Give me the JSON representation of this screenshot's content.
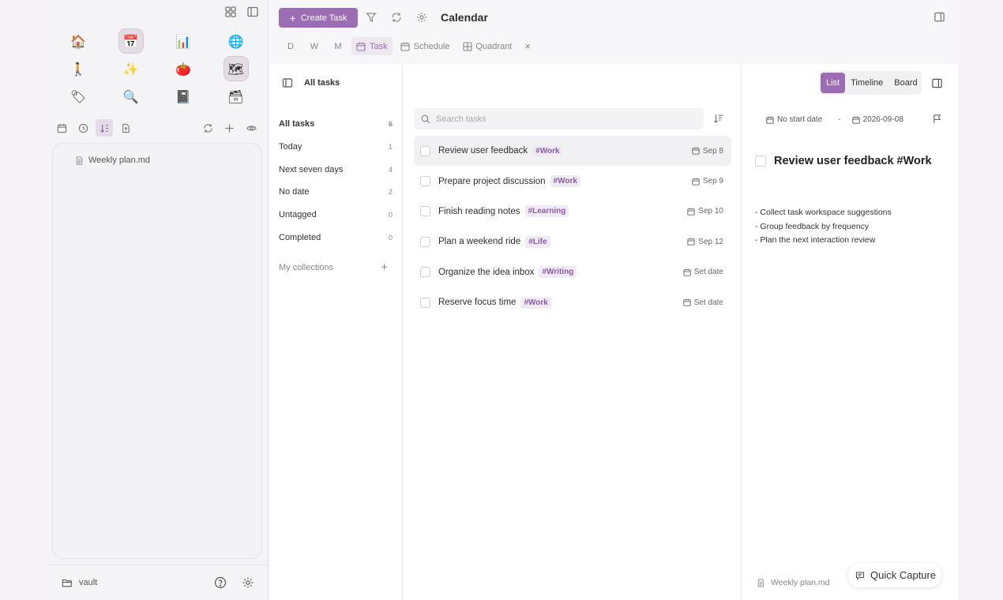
{
  "sidebar": {
    "emoji_icons": [
      {
        "name": "home-icon",
        "glyph": "🏠",
        "active": false
      },
      {
        "name": "calendar-icon",
        "glyph": "📅",
        "active": true
      },
      {
        "name": "bar-chart-icon",
        "glyph": "📊",
        "active": false
      },
      {
        "name": "globe-icon",
        "glyph": "🌐",
        "active": false
      },
      {
        "name": "walking-person-icon",
        "glyph": "🚶",
        "active": false
      },
      {
        "name": "sparkles-icon",
        "glyph": "✨",
        "active": false
      },
      {
        "name": "tomato-icon",
        "glyph": "🍅",
        "active": false
      },
      {
        "name": "map-icon",
        "glyph": "🗺",
        "active": true
      },
      {
        "name": "label-tag-icon",
        "glyph": "🏷",
        "active": false
      },
      {
        "name": "magnifier-icon",
        "glyph": "🔍",
        "active": false
      },
      {
        "name": "notebook-icon",
        "glyph": "📓",
        "active": false
      },
      {
        "name": "file-box-icon",
        "glyph": "🗃",
        "active": false
      }
    ],
    "file": "Weekly plan.md",
    "vault": "vault"
  },
  "header": {
    "create_label": "Create Task",
    "title": "Calendar",
    "views": {
      "d": "D",
      "w": "W",
      "m": "M",
      "task": "Task",
      "schedule": "Schedule",
      "quadrant": "Quadrant"
    },
    "close": "×"
  },
  "nav": {
    "heading": "All tasks",
    "items": [
      {
        "label": "All tasks",
        "count": "6"
      },
      {
        "label": "Today",
        "count": "1"
      },
      {
        "label": "Next seven days",
        "count": "4"
      },
      {
        "label": "No date",
        "count": "2"
      },
      {
        "label": "Untagged",
        "count": "0"
      },
      {
        "label": "Completed",
        "count": "0"
      }
    ],
    "collections_label": "My collections",
    "add": "+"
  },
  "tasks": {
    "search_placeholder": "Search tasks",
    "items": [
      {
        "title": "Review user feedback",
        "tag": "#Work",
        "date": "Sep 8",
        "selected": true
      },
      {
        "title": "Prepare project discussion",
        "tag": "#Work",
        "date": "Sep 9",
        "selected": false
      },
      {
        "title": "Finish reading notes",
        "tag": "#Learning",
        "date": "Sep 10",
        "selected": false
      },
      {
        "title": "Plan a weekend ride",
        "tag": "#Life",
        "date": "Sep 12",
        "selected": false
      },
      {
        "title": "Organize the idea inbox",
        "tag": "#Writing",
        "date": "Set date",
        "selected": false
      },
      {
        "title": "Reserve focus time",
        "tag": "#Work",
        "date": "Set date",
        "selected": false
      }
    ]
  },
  "detail": {
    "tabs": {
      "list": "List",
      "timeline": "Timeline",
      "board": "Board"
    },
    "start_date": "No start date",
    "dash": "-",
    "due_date": "2026-09-08",
    "title": "Review user feedback #Work",
    "notes": [
      "- Collect task workspace suggestions",
      "- Group feedback by frequency",
      "- Plan the next interaction review"
    ],
    "file": "Weekly plan.md"
  },
  "quick_capture": "Quick Capture",
  "colors": {
    "accent": "#9c6cb4",
    "tag_bg": "#f0ebf3",
    "tag_text": "#8a5aa8"
  }
}
